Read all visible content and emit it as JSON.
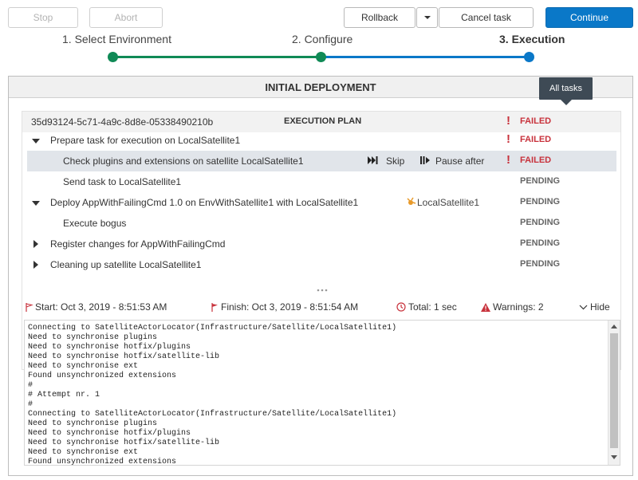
{
  "toolbar": {
    "stop_label": "Stop",
    "abort_label": "Abort",
    "rollback_label": "Rollback",
    "cancel_label": "Cancel task",
    "continue_label": "Continue"
  },
  "steps": [
    {
      "label": "1. Select Environment"
    },
    {
      "label": "2. Configure"
    },
    {
      "label": "3. Execution"
    }
  ],
  "panel": {
    "title": "INITIAL DEPLOYMENT",
    "tooltip": "All tasks"
  },
  "plan": {
    "id": "35d93124-5c71-4a9c-8d8e-05338490210b",
    "header": "EXECUTION PLAN",
    "header_status": "FAILED",
    "rows": [
      {
        "label": "Prepare task for execution on LocalSatellite1",
        "status": "FAILED"
      },
      {
        "label": "Check plugins and extensions on satellite LocalSatellite1",
        "status": "FAILED",
        "skip": "Skip",
        "pause": "Pause after"
      },
      {
        "label": "Send task to LocalSatellite1",
        "status": "PENDING"
      },
      {
        "label": "Deploy AppWithFailingCmd 1.0 on EnvWithSatellite1 with LocalSatellite1",
        "status": "PENDING",
        "target": "LocalSatellite1"
      },
      {
        "label": "Execute bogus",
        "status": "PENDING"
      },
      {
        "label": "Register changes for AppWithFailingCmd",
        "status": "PENDING"
      },
      {
        "label": "Cleaning up satellite LocalSatellite1",
        "status": "PENDING"
      }
    ]
  },
  "summary": {
    "start": "Start: Oct 3, 2019 - 8:51:53 AM",
    "finish": "Finish: Oct 3, 2019 - 8:51:54 AM",
    "total": "Total: 1 sec",
    "warnings": "Warnings: 2",
    "hide": "Hide"
  },
  "log": {
    "lines": [
      "Connecting to SatelliteActorLocator(Infrastructure/Satellite/LocalSatellite1)",
      "Need to synchronise plugins",
      "Need to synchronise hotfix/plugins",
      "Need to synchronise hotfix/satellite-lib",
      "Need to synchronise ext",
      "Found unsynchronized extensions",
      "#",
      "# Attempt nr. 1",
      "#",
      "Connecting to SatelliteActorLocator(Infrastructure/Satellite/LocalSatellite1)",
      "Need to synchronise plugins",
      "Need to synchronise hotfix/plugins",
      "Need to synchronise hotfix/satellite-lib",
      "Need to synchronise ext",
      "Found unsynchronized extensions"
    ]
  },
  "colors": {
    "accent": "#0a78c8",
    "done_step": "#108a56",
    "failed": "#c8323c"
  }
}
